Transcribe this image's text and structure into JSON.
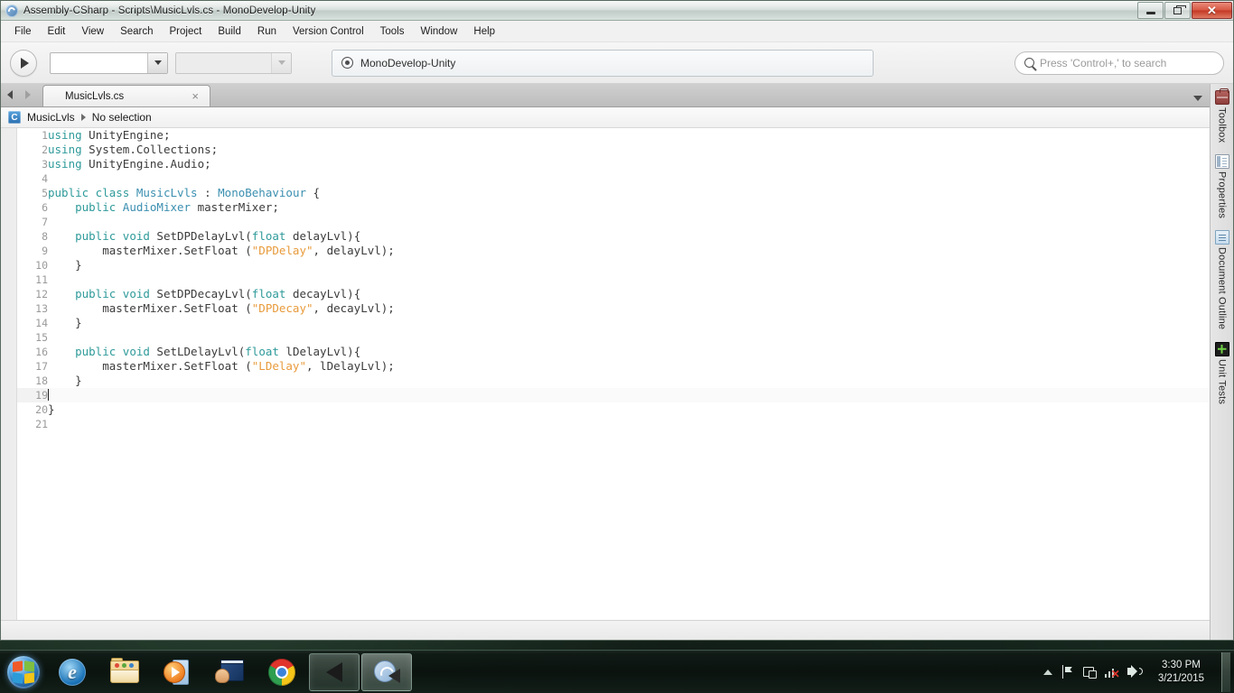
{
  "window": {
    "title": "Assembly-CSharp - Scripts\\MusicLvls.cs - MonoDevelop-Unity",
    "app_icon": "monodevelop-icon",
    "controls": {
      "minimize": "minimize-icon",
      "maximize": "maximize-icon",
      "close": "close-icon"
    }
  },
  "menubar": {
    "items": [
      {
        "label": "File"
      },
      {
        "label": "Edit"
      },
      {
        "label": "View"
      },
      {
        "label": "Search"
      },
      {
        "label": "Project"
      },
      {
        "label": "Build"
      },
      {
        "label": "Run"
      },
      {
        "label": "Version Control"
      },
      {
        "label": "Tools"
      },
      {
        "label": "Window"
      },
      {
        "label": "Help"
      }
    ]
  },
  "toolbar": {
    "run_button": "run-icon",
    "configuration_combo": {
      "value": "",
      "arrow": "chevron-down-icon"
    },
    "platform_combo": {
      "value": "",
      "arrow": "chevron-down-icon"
    },
    "status_panel": {
      "icon": "target-icon",
      "text": "MonoDevelop-Unity"
    },
    "search": {
      "icon": "search-icon",
      "placeholder": "Press 'Control+,' to search",
      "value": ""
    }
  },
  "tabstrip": {
    "back_arrow": "chevron-left-icon",
    "forward_arrow": "chevron-right-icon",
    "tabs": [
      {
        "label": "MusicLvls.cs",
        "close": "×",
        "active": true
      }
    ],
    "overflow_menu": "chevron-down-icon"
  },
  "breadcrumb": {
    "icon": "csharp-class-icon",
    "icon_letter": "C",
    "path": [
      "MusicLvls",
      "No selection"
    ],
    "separator": "▶"
  },
  "editor": {
    "cursor_line": 19,
    "lines": [
      {
        "n": 1,
        "tokens": [
          {
            "t": "using",
            "c": "kw"
          },
          {
            "t": " UnityEngine;",
            "c": "pl"
          }
        ]
      },
      {
        "n": 2,
        "tokens": [
          {
            "t": "using",
            "c": "kw"
          },
          {
            "t": " System.Collections;",
            "c": "pl"
          }
        ]
      },
      {
        "n": 3,
        "tokens": [
          {
            "t": "using",
            "c": "kw"
          },
          {
            "t": " UnityEngine.Audio;",
            "c": "pl"
          }
        ]
      },
      {
        "n": 4,
        "tokens": []
      },
      {
        "n": 5,
        "tokens": [
          {
            "t": "public class",
            "c": "kw"
          },
          {
            "t": " ",
            "c": "pl"
          },
          {
            "t": "MusicLvls",
            "c": "typ"
          },
          {
            "t": " : ",
            "c": "pl"
          },
          {
            "t": "MonoBehaviour",
            "c": "typ"
          },
          {
            "t": " {",
            "c": "pl"
          }
        ]
      },
      {
        "n": 6,
        "tokens": [
          {
            "t": "    ",
            "c": "pl"
          },
          {
            "t": "public",
            "c": "kw"
          },
          {
            "t": " ",
            "c": "pl"
          },
          {
            "t": "AudioMixer",
            "c": "typ"
          },
          {
            "t": " masterMixer;",
            "c": "pl"
          }
        ]
      },
      {
        "n": 7,
        "tokens": []
      },
      {
        "n": 8,
        "tokens": [
          {
            "t": "    ",
            "c": "pl"
          },
          {
            "t": "public void",
            "c": "kw"
          },
          {
            "t": " SetDPDelayLvl(",
            "c": "pl"
          },
          {
            "t": "float",
            "c": "kw"
          },
          {
            "t": " delayLvl){",
            "c": "pl"
          }
        ]
      },
      {
        "n": 9,
        "tokens": [
          {
            "t": "        masterMixer.SetFloat (",
            "c": "pl"
          },
          {
            "t": "\"DPDelay\"",
            "c": "str"
          },
          {
            "t": ", delayLvl);",
            "c": "pl"
          }
        ]
      },
      {
        "n": 10,
        "tokens": [
          {
            "t": "    }",
            "c": "pl"
          }
        ]
      },
      {
        "n": 11,
        "tokens": []
      },
      {
        "n": 12,
        "tokens": [
          {
            "t": "    ",
            "c": "pl"
          },
          {
            "t": "public void",
            "c": "kw"
          },
          {
            "t": " SetDPDecayLvl(",
            "c": "pl"
          },
          {
            "t": "float",
            "c": "kw"
          },
          {
            "t": " decayLvl){",
            "c": "pl"
          }
        ]
      },
      {
        "n": 13,
        "tokens": [
          {
            "t": "        masterMixer.SetFloat (",
            "c": "pl"
          },
          {
            "t": "\"DPDecay\"",
            "c": "str"
          },
          {
            "t": ", decayLvl);",
            "c": "pl"
          }
        ]
      },
      {
        "n": 14,
        "tokens": [
          {
            "t": "    }",
            "c": "pl"
          }
        ]
      },
      {
        "n": 15,
        "tokens": []
      },
      {
        "n": 16,
        "tokens": [
          {
            "t": "    ",
            "c": "pl"
          },
          {
            "t": "public void",
            "c": "kw"
          },
          {
            "t": " SetLDelayLvl(",
            "c": "pl"
          },
          {
            "t": "float",
            "c": "kw"
          },
          {
            "t": " lDelayLvl){",
            "c": "pl"
          }
        ]
      },
      {
        "n": 17,
        "tokens": [
          {
            "t": "        masterMixer.SetFloat (",
            "c": "pl"
          },
          {
            "t": "\"LDelay\"",
            "c": "str"
          },
          {
            "t": ", lDelayLvl);",
            "c": "pl"
          }
        ]
      },
      {
        "n": 18,
        "tokens": [
          {
            "t": "    }",
            "c": "pl"
          }
        ]
      },
      {
        "n": 19,
        "tokens": []
      },
      {
        "n": 20,
        "tokens": [
          {
            "t": "}",
            "c": "pl"
          }
        ]
      },
      {
        "n": 21,
        "tokens": []
      }
    ]
  },
  "right_pads": {
    "items": [
      {
        "label": "Toolbox",
        "icon": "toolbox-icon"
      },
      {
        "label": "Properties",
        "icon": "properties-icon"
      },
      {
        "label": "Document Outline",
        "icon": "document-outline-icon"
      },
      {
        "label": "Unit Tests",
        "icon": "unit-tests-icon"
      }
    ]
  },
  "taskbar": {
    "start": "windows-start-orb-icon",
    "buttons": [
      {
        "name": "internet-explorer",
        "icon": "internet-explorer-icon",
        "active": false
      },
      {
        "name": "windows-explorer",
        "icon": "folder-icon",
        "active": false
      },
      {
        "name": "windows-media-player",
        "icon": "media-player-icon",
        "active": false
      },
      {
        "name": "remote-desktop",
        "icon": "remote-desktop-icon",
        "active": false
      },
      {
        "name": "google-chrome",
        "icon": "chrome-icon",
        "active": false
      },
      {
        "name": "unity",
        "icon": "unity-icon",
        "active": true
      },
      {
        "name": "monodevelop",
        "icon": "monodevelop-icon",
        "active": true
      }
    ],
    "tray": {
      "show_hidden": "chevron-up-icon",
      "icons": [
        {
          "name": "action-center-flag",
          "icon": "flag-icon"
        },
        {
          "name": "safely-remove-hardware",
          "icon": "eject-icon"
        },
        {
          "name": "network",
          "icon": "network-bars-icon",
          "muted_marker": "✕"
        },
        {
          "name": "volume",
          "icon": "speaker-icon"
        }
      ],
      "clock": {
        "time": "3:30 PM",
        "date": "3/21/2015"
      },
      "show_desktop": "show-desktop-button"
    }
  },
  "colors": {
    "keyword": "#2f9a9a",
    "type": "#3b8fb0",
    "string": "#e89b3c",
    "plain": "#3b3b3b",
    "line_number": "#9a9a9a",
    "editor_bg": "#ffffff",
    "chrome_bg": "#f0f0f0"
  }
}
